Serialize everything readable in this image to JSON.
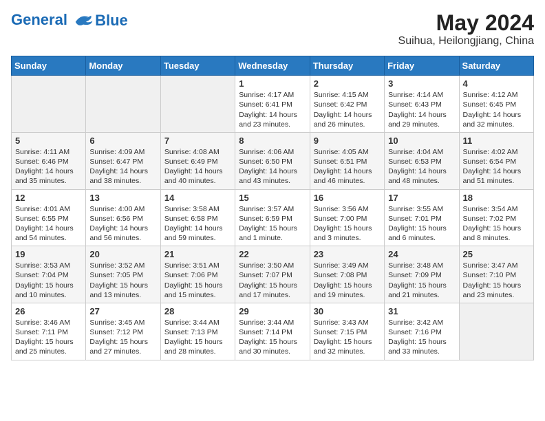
{
  "header": {
    "logo_line1": "General",
    "logo_line2": "Blue",
    "title": "May 2024",
    "subtitle": "Suihua, Heilongjiang, China"
  },
  "days_of_week": [
    "Sunday",
    "Monday",
    "Tuesday",
    "Wednesday",
    "Thursday",
    "Friday",
    "Saturday"
  ],
  "weeks": [
    [
      {
        "day": "",
        "content": ""
      },
      {
        "day": "",
        "content": ""
      },
      {
        "day": "",
        "content": ""
      },
      {
        "day": "1",
        "content": "Sunrise: 4:17 AM\nSunset: 6:41 PM\nDaylight: 14 hours\nand 23 minutes."
      },
      {
        "day": "2",
        "content": "Sunrise: 4:15 AM\nSunset: 6:42 PM\nDaylight: 14 hours\nand 26 minutes."
      },
      {
        "day": "3",
        "content": "Sunrise: 4:14 AM\nSunset: 6:43 PM\nDaylight: 14 hours\nand 29 minutes."
      },
      {
        "day": "4",
        "content": "Sunrise: 4:12 AM\nSunset: 6:45 PM\nDaylight: 14 hours\nand 32 minutes."
      }
    ],
    [
      {
        "day": "5",
        "content": "Sunrise: 4:11 AM\nSunset: 6:46 PM\nDaylight: 14 hours\nand 35 minutes."
      },
      {
        "day": "6",
        "content": "Sunrise: 4:09 AM\nSunset: 6:47 PM\nDaylight: 14 hours\nand 38 minutes."
      },
      {
        "day": "7",
        "content": "Sunrise: 4:08 AM\nSunset: 6:49 PM\nDaylight: 14 hours\nand 40 minutes."
      },
      {
        "day": "8",
        "content": "Sunrise: 4:06 AM\nSunset: 6:50 PM\nDaylight: 14 hours\nand 43 minutes."
      },
      {
        "day": "9",
        "content": "Sunrise: 4:05 AM\nSunset: 6:51 PM\nDaylight: 14 hours\nand 46 minutes."
      },
      {
        "day": "10",
        "content": "Sunrise: 4:04 AM\nSunset: 6:53 PM\nDaylight: 14 hours\nand 48 minutes."
      },
      {
        "day": "11",
        "content": "Sunrise: 4:02 AM\nSunset: 6:54 PM\nDaylight: 14 hours\nand 51 minutes."
      }
    ],
    [
      {
        "day": "12",
        "content": "Sunrise: 4:01 AM\nSunset: 6:55 PM\nDaylight: 14 hours\nand 54 minutes."
      },
      {
        "day": "13",
        "content": "Sunrise: 4:00 AM\nSunset: 6:56 PM\nDaylight: 14 hours\nand 56 minutes."
      },
      {
        "day": "14",
        "content": "Sunrise: 3:58 AM\nSunset: 6:58 PM\nDaylight: 14 hours\nand 59 minutes."
      },
      {
        "day": "15",
        "content": "Sunrise: 3:57 AM\nSunset: 6:59 PM\nDaylight: 15 hours\nand 1 minute."
      },
      {
        "day": "16",
        "content": "Sunrise: 3:56 AM\nSunset: 7:00 PM\nDaylight: 15 hours\nand 3 minutes."
      },
      {
        "day": "17",
        "content": "Sunrise: 3:55 AM\nSunset: 7:01 PM\nDaylight: 15 hours\nand 6 minutes."
      },
      {
        "day": "18",
        "content": "Sunrise: 3:54 AM\nSunset: 7:02 PM\nDaylight: 15 hours\nand 8 minutes."
      }
    ],
    [
      {
        "day": "19",
        "content": "Sunrise: 3:53 AM\nSunset: 7:04 PM\nDaylight: 15 hours\nand 10 minutes."
      },
      {
        "day": "20",
        "content": "Sunrise: 3:52 AM\nSunset: 7:05 PM\nDaylight: 15 hours\nand 13 minutes."
      },
      {
        "day": "21",
        "content": "Sunrise: 3:51 AM\nSunset: 7:06 PM\nDaylight: 15 hours\nand 15 minutes."
      },
      {
        "day": "22",
        "content": "Sunrise: 3:50 AM\nSunset: 7:07 PM\nDaylight: 15 hours\nand 17 minutes."
      },
      {
        "day": "23",
        "content": "Sunrise: 3:49 AM\nSunset: 7:08 PM\nDaylight: 15 hours\nand 19 minutes."
      },
      {
        "day": "24",
        "content": "Sunrise: 3:48 AM\nSunset: 7:09 PM\nDaylight: 15 hours\nand 21 minutes."
      },
      {
        "day": "25",
        "content": "Sunrise: 3:47 AM\nSunset: 7:10 PM\nDaylight: 15 hours\nand 23 minutes."
      }
    ],
    [
      {
        "day": "26",
        "content": "Sunrise: 3:46 AM\nSunset: 7:11 PM\nDaylight: 15 hours\nand 25 minutes."
      },
      {
        "day": "27",
        "content": "Sunrise: 3:45 AM\nSunset: 7:12 PM\nDaylight: 15 hours\nand 27 minutes."
      },
      {
        "day": "28",
        "content": "Sunrise: 3:44 AM\nSunset: 7:13 PM\nDaylight: 15 hours\nand 28 minutes."
      },
      {
        "day": "29",
        "content": "Sunrise: 3:44 AM\nSunset: 7:14 PM\nDaylight: 15 hours\nand 30 minutes."
      },
      {
        "day": "30",
        "content": "Sunrise: 3:43 AM\nSunset: 7:15 PM\nDaylight: 15 hours\nand 32 minutes."
      },
      {
        "day": "31",
        "content": "Sunrise: 3:42 AM\nSunset: 7:16 PM\nDaylight: 15 hours\nand 33 minutes."
      },
      {
        "day": "",
        "content": ""
      }
    ]
  ]
}
